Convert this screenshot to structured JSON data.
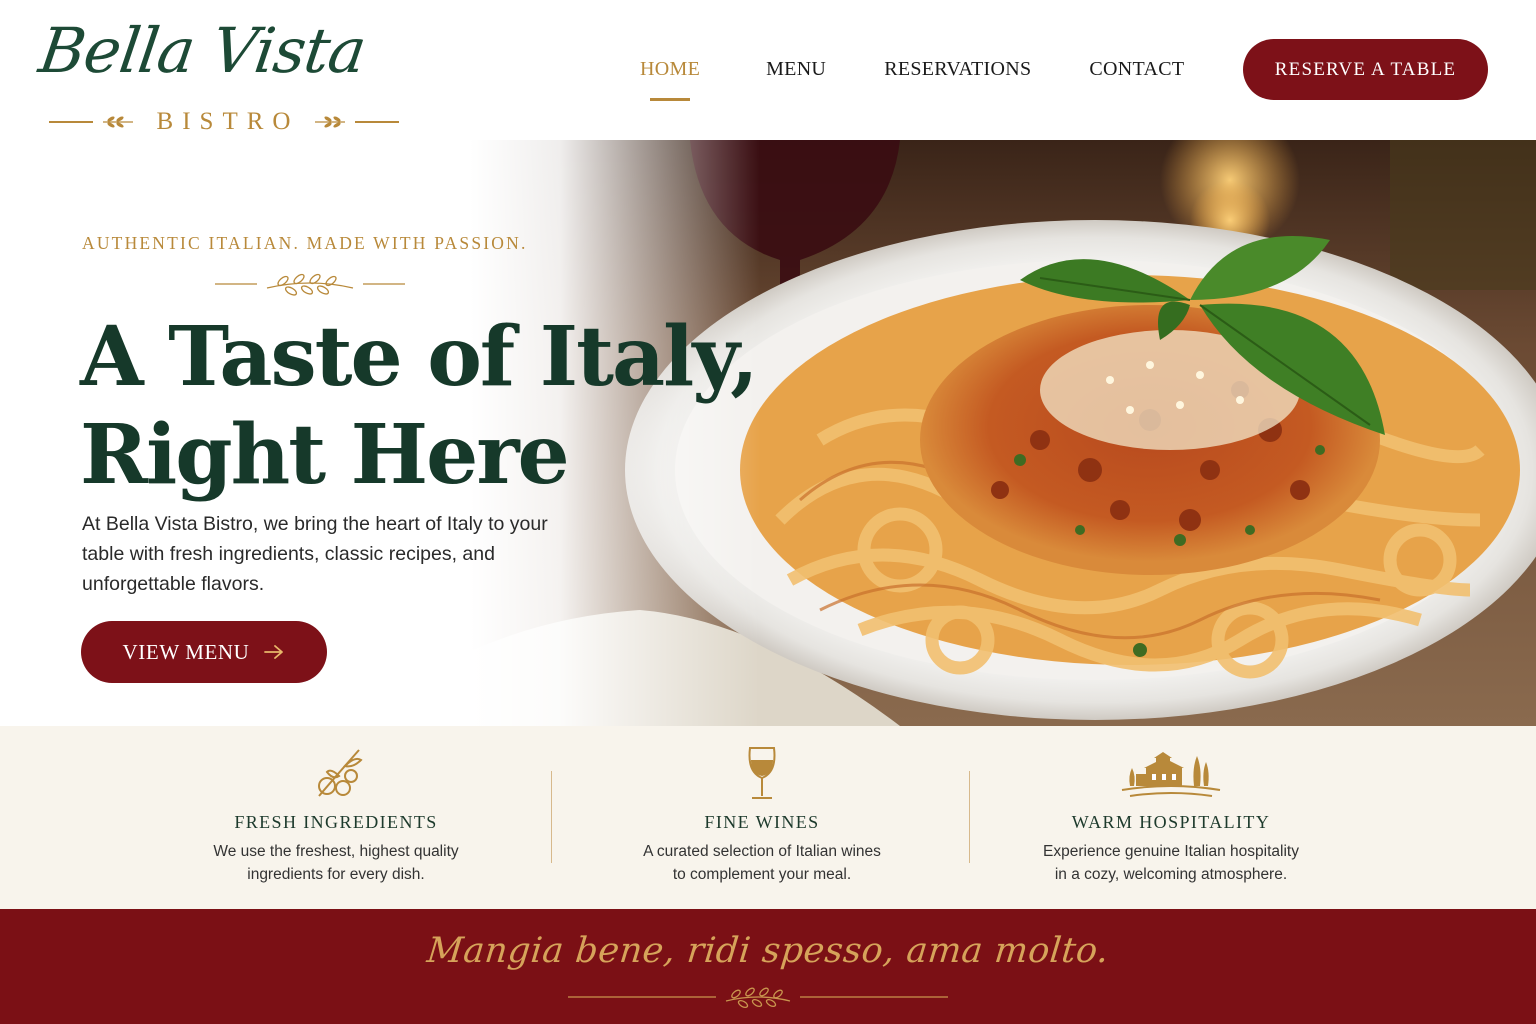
{
  "brand": {
    "name": "Bella Vista",
    "subtitle": "BISTRO"
  },
  "nav": {
    "items": [
      {
        "label": "HOME",
        "active": true
      },
      {
        "label": "MENU",
        "active": false
      },
      {
        "label": "RESERVATIONS",
        "active": false
      },
      {
        "label": "CONTACT",
        "active": false
      }
    ],
    "cta_label": "RESERVE A TABLE"
  },
  "hero": {
    "eyebrow": "AUTHENTIC ITALIAN.  MADE WITH PASSION.",
    "headline_line1": "A Taste of Italy,",
    "headline_line2": "Right Here",
    "intro": "At Bella Vista Bistro, we bring the heart of Italy to your table with fresh ingredients, classic recipes, and unforgettable flavors.",
    "button_label": "VIEW MENU",
    "button_icon": "arrow-right-icon"
  },
  "features": [
    {
      "icon": "olive-branch-icon",
      "title": "FRESH INGREDIENTS",
      "desc_line1": "We use the freshest, highest quality",
      "desc_line2": "ingredients for every dish."
    },
    {
      "icon": "wine-glass-icon",
      "title": "FINE WINES",
      "desc_line1": "A curated selection of Italian wines",
      "desc_line2": "to complement your meal."
    },
    {
      "icon": "tuscan-villa-icon",
      "title": "WARM HOSPITALITY",
      "desc_line1": "Experience genuine Italian hospitality",
      "desc_line2": "in a cozy, welcoming atmosphere."
    }
  ],
  "footer": {
    "quote": "Mangia bene, ridi spesso, ama molto."
  },
  "colors": {
    "burgundy": "#7d1118",
    "gold": "#b8893a",
    "forest_green": "#16392a",
    "cream": "#f8f4ec"
  }
}
